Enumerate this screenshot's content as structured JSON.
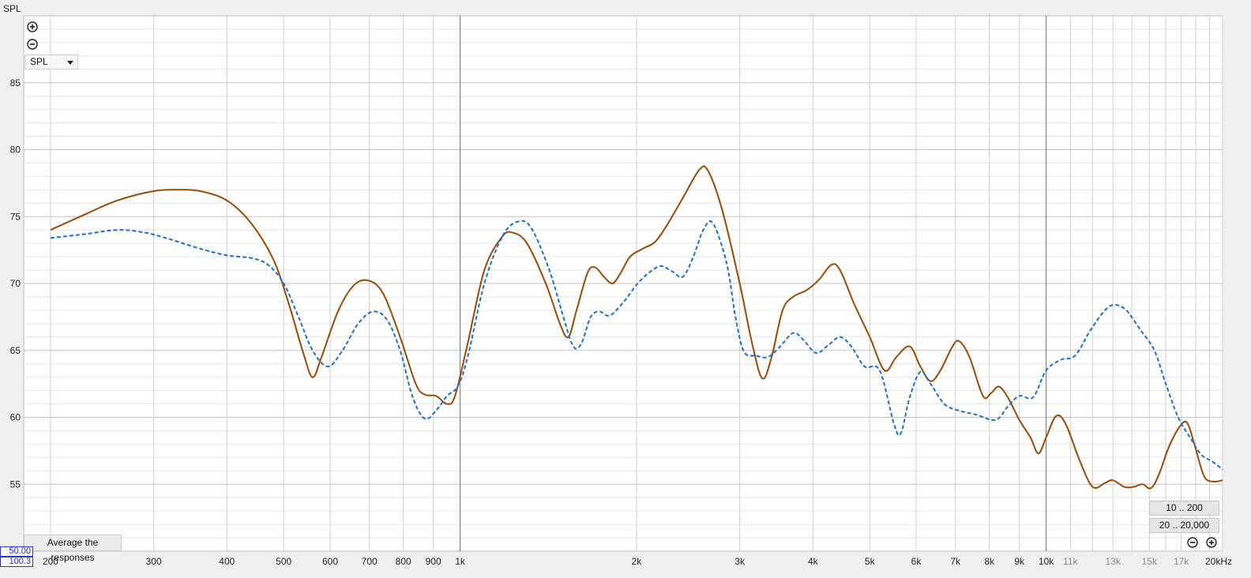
{
  "chart_data": {
    "type": "line",
    "ylabel": "SPL",
    "xscale": "log",
    "xlim": [
      180,
      20000
    ],
    "ylim": [
      50,
      90
    ],
    "grid": true,
    "y_ticks": [
      55,
      60,
      65,
      70,
      75,
      80,
      85
    ],
    "x_ticks": [
      {
        "v": 200,
        "label": "200"
      },
      {
        "v": 300,
        "label": "300"
      },
      {
        "v": 400,
        "label": "400"
      },
      {
        "v": 500,
        "label": "500"
      },
      {
        "v": 600,
        "label": "600"
      },
      {
        "v": 700,
        "label": "700"
      },
      {
        "v": 800,
        "label": "800"
      },
      {
        "v": 900,
        "label": "900"
      },
      {
        "v": 1000,
        "label": "1k"
      },
      {
        "v": 2000,
        "label": "2k"
      },
      {
        "v": 3000,
        "label": "3k"
      },
      {
        "v": 4000,
        "label": "4k"
      },
      {
        "v": 5000,
        "label": "5k"
      },
      {
        "v": 6000,
        "label": "6k"
      },
      {
        "v": 7000,
        "label": "7k"
      },
      {
        "v": 8000,
        "label": "8k"
      },
      {
        "v": 9000,
        "label": "9k"
      },
      {
        "v": 10000,
        "label": "10k"
      },
      {
        "v": 11000,
        "label": "11k"
      },
      {
        "v": 13000,
        "label": "13k"
      },
      {
        "v": 15000,
        "label": "15k"
      },
      {
        "v": 17000,
        "label": "17k"
      },
      {
        "v": 20000,
        "label": "20kHz"
      }
    ],
    "series": [
      {
        "color": "#9b4a05",
        "style": "solid",
        "points": [
          [
            200,
            74.0
          ],
          [
            230,
            75.2
          ],
          [
            260,
            76.2
          ],
          [
            300,
            76.9
          ],
          [
            330,
            77.0
          ],
          [
            360,
            76.9
          ],
          [
            400,
            76.2
          ],
          [
            440,
            74.5
          ],
          [
            480,
            71.8
          ],
          [
            510,
            68.5
          ],
          [
            540,
            64.8
          ],
          [
            560,
            63.0
          ],
          [
            580,
            64.5
          ],
          [
            620,
            68.0
          ],
          [
            660,
            69.9
          ],
          [
            700,
            70.2
          ],
          [
            740,
            69.2
          ],
          [
            790,
            66.0
          ],
          [
            840,
            62.5
          ],
          [
            870,
            61.7
          ],
          [
            910,
            61.6
          ],
          [
            950,
            61.0
          ],
          [
            980,
            61.6
          ],
          [
            1030,
            65.5
          ],
          [
            1100,
            71.0
          ],
          [
            1180,
            73.5
          ],
          [
            1230,
            73.8
          ],
          [
            1300,
            73.0
          ],
          [
            1400,
            70.0
          ],
          [
            1480,
            67.0
          ],
          [
            1530,
            66.0
          ],
          [
            1580,
            68.0
          ],
          [
            1650,
            70.8
          ],
          [
            1700,
            71.2
          ],
          [
            1760,
            70.5
          ],
          [
            1820,
            70.0
          ],
          [
            1880,
            70.8
          ],
          [
            1950,
            72.0
          ],
          [
            2050,
            72.6
          ],
          [
            2150,
            73.1
          ],
          [
            2250,
            74.3
          ],
          [
            2400,
            76.4
          ],
          [
            2560,
            78.5
          ],
          [
            2650,
            78.4
          ],
          [
            2800,
            75.5
          ],
          [
            3000,
            70.0
          ],
          [
            3150,
            65.5
          ],
          [
            3280,
            62.9
          ],
          [
            3400,
            64.5
          ],
          [
            3550,
            68.0
          ],
          [
            3700,
            69.0
          ],
          [
            3900,
            69.5
          ],
          [
            4100,
            70.3
          ],
          [
            4300,
            71.4
          ],
          [
            4450,
            71.0
          ],
          [
            4700,
            68.5
          ],
          [
            5000,
            66.0
          ],
          [
            5300,
            63.5
          ],
          [
            5550,
            64.5
          ],
          [
            5850,
            65.3
          ],
          [
            6100,
            63.8
          ],
          [
            6350,
            62.7
          ],
          [
            6600,
            63.5
          ],
          [
            6900,
            65.2
          ],
          [
            7100,
            65.7
          ],
          [
            7400,
            64.5
          ],
          [
            7800,
            61.6
          ],
          [
            8050,
            61.8
          ],
          [
            8300,
            62.3
          ],
          [
            8600,
            61.5
          ],
          [
            9000,
            59.8
          ],
          [
            9400,
            58.5
          ],
          [
            9700,
            57.3
          ],
          [
            10000,
            58.5
          ],
          [
            10400,
            60.1
          ],
          [
            10800,
            59.5
          ],
          [
            11400,
            56.8
          ],
          [
            12000,
            54.8
          ],
          [
            12600,
            55.1
          ],
          [
            13000,
            55.3
          ],
          [
            13600,
            54.8
          ],
          [
            14100,
            54.8
          ],
          [
            14600,
            55.0
          ],
          [
            15100,
            54.7
          ],
          [
            15600,
            55.8
          ],
          [
            16200,
            57.8
          ],
          [
            16900,
            59.3
          ],
          [
            17400,
            59.6
          ],
          [
            17900,
            58.0
          ],
          [
            18600,
            55.6
          ],
          [
            19300,
            55.2
          ],
          [
            20000,
            55.3
          ]
        ]
      },
      {
        "color": "#1a6fd6",
        "style": "dashed",
        "points": [
          [
            200,
            73.4
          ],
          [
            230,
            73.7
          ],
          [
            260,
            74.0
          ],
          [
            290,
            73.8
          ],
          [
            320,
            73.3
          ],
          [
            360,
            72.6
          ],
          [
            400,
            72.1
          ],
          [
            440,
            71.9
          ],
          [
            470,
            71.4
          ],
          [
            500,
            70.0
          ],
          [
            530,
            67.5
          ],
          [
            560,
            65.0
          ],
          [
            595,
            63.8
          ],
          [
            630,
            65.0
          ],
          [
            670,
            67.0
          ],
          [
            710,
            67.9
          ],
          [
            750,
            67.3
          ],
          [
            790,
            65.0
          ],
          [
            830,
            61.5
          ],
          [
            870,
            59.9
          ],
          [
            910,
            60.5
          ],
          [
            950,
            61.6
          ],
          [
            990,
            62.3
          ],
          [
            1030,
            64.5
          ],
          [
            1100,
            70.0
          ],
          [
            1180,
            73.5
          ],
          [
            1250,
            74.6
          ],
          [
            1320,
            74.2
          ],
          [
            1420,
            71.0
          ],
          [
            1500,
            67.5
          ],
          [
            1560,
            65.3
          ],
          [
            1610,
            65.5
          ],
          [
            1670,
            67.5
          ],
          [
            1730,
            67.9
          ],
          [
            1800,
            67.6
          ],
          [
            1900,
            68.6
          ],
          [
            2000,
            69.9
          ],
          [
            2100,
            70.8
          ],
          [
            2200,
            71.3
          ],
          [
            2300,
            70.9
          ],
          [
            2400,
            70.5
          ],
          [
            2500,
            72.0
          ],
          [
            2600,
            74.0
          ],
          [
            2700,
            74.5
          ],
          [
            2850,
            71.5
          ],
          [
            2950,
            67.5
          ],
          [
            3050,
            64.9
          ],
          [
            3200,
            64.6
          ],
          [
            3350,
            64.5
          ],
          [
            3500,
            65.2
          ],
          [
            3700,
            66.3
          ],
          [
            3850,
            65.8
          ],
          [
            4050,
            64.8
          ],
          [
            4250,
            65.4
          ],
          [
            4450,
            66.0
          ],
          [
            4650,
            65.3
          ],
          [
            4900,
            63.8
          ],
          [
            5200,
            63.5
          ],
          [
            5500,
            59.5
          ],
          [
            5650,
            58.8
          ],
          [
            5850,
            61.5
          ],
          [
            6100,
            63.4
          ],
          [
            6350,
            62.5
          ],
          [
            6700,
            61.0
          ],
          [
            7100,
            60.5
          ],
          [
            7600,
            60.2
          ],
          [
            8200,
            59.8
          ],
          [
            8600,
            60.8
          ],
          [
            9000,
            61.6
          ],
          [
            9500,
            61.5
          ],
          [
            10000,
            63.5
          ],
          [
            10600,
            64.3
          ],
          [
            11200,
            64.6
          ],
          [
            11900,
            66.5
          ],
          [
            12600,
            68.0
          ],
          [
            13100,
            68.4
          ],
          [
            13700,
            68.0
          ],
          [
            14500,
            66.5
          ],
          [
            15300,
            65.0
          ],
          [
            16000,
            62.5
          ],
          [
            16800,
            60.0
          ],
          [
            17600,
            58.5
          ],
          [
            18400,
            57.2
          ],
          [
            19200,
            56.7
          ],
          [
            20000,
            56.1
          ]
        ]
      }
    ]
  },
  "ui": {
    "y_axis_title": "SPL",
    "zoom_in_icon": "plus-circle-icon",
    "zoom_out_icon": "minus-circle-icon",
    "measurement_select": "SPL",
    "average_button": "Average the responses",
    "range_button_1": "10 .. 200",
    "range_button_2": "20 .. 20,000",
    "corner_top": "50.00",
    "corner_bottom": "100.3"
  }
}
